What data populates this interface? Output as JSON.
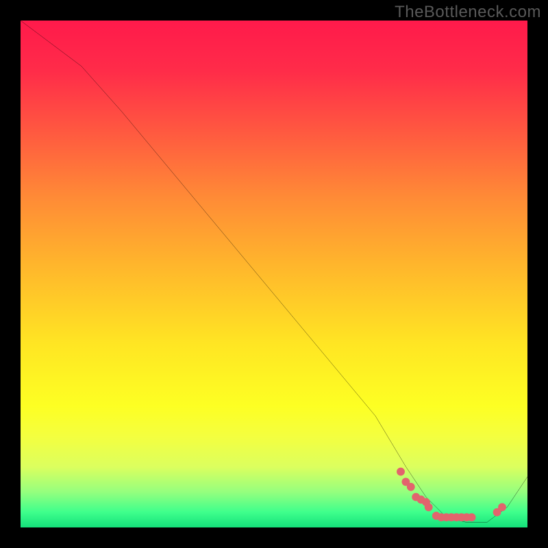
{
  "watermark": "TheBottleneck.com",
  "chart_data": {
    "type": "line",
    "title": "",
    "xlabel": "",
    "ylabel": "",
    "xlim": [
      0,
      100
    ],
    "ylim": [
      0,
      100
    ],
    "grid": false,
    "series": [
      {
        "name": "curve",
        "x": [
          0,
          8,
          12,
          20,
          30,
          40,
          50,
          60,
          70,
          76,
          80,
          84,
          88,
          92,
          96,
          100
        ],
        "values": [
          100,
          94,
          91,
          82,
          70,
          58,
          46,
          34,
          22,
          12,
          6,
          2,
          1,
          1,
          4,
          10
        ]
      }
    ],
    "markers": {
      "name": "dots",
      "x": [
        75,
        76,
        77,
        78,
        79,
        80,
        80.5,
        82,
        83,
        84,
        85,
        86,
        87,
        88,
        89,
        94,
        95
      ],
      "values": [
        11,
        9,
        8,
        6,
        5.5,
        5,
        4,
        2.3,
        2,
        2,
        2,
        2,
        2,
        2,
        2,
        3,
        4
      ],
      "color": "#e2646d"
    },
    "gradient": {
      "stops": [
        {
          "pos": 0,
          "color": "#ff1a4b"
        },
        {
          "pos": 10,
          "color": "#ff2c49"
        },
        {
          "pos": 22,
          "color": "#ff5940"
        },
        {
          "pos": 35,
          "color": "#ff8b36"
        },
        {
          "pos": 48,
          "color": "#ffb52c"
        },
        {
          "pos": 64,
          "color": "#ffe623"
        },
        {
          "pos": 76,
          "color": "#fdff23"
        },
        {
          "pos": 82,
          "color": "#f4ff3f"
        },
        {
          "pos": 88,
          "color": "#dcff5e"
        },
        {
          "pos": 93,
          "color": "#95ff7e"
        },
        {
          "pos": 97,
          "color": "#3eff8c"
        },
        {
          "pos": 100,
          "color": "#14e07a"
        }
      ]
    }
  }
}
